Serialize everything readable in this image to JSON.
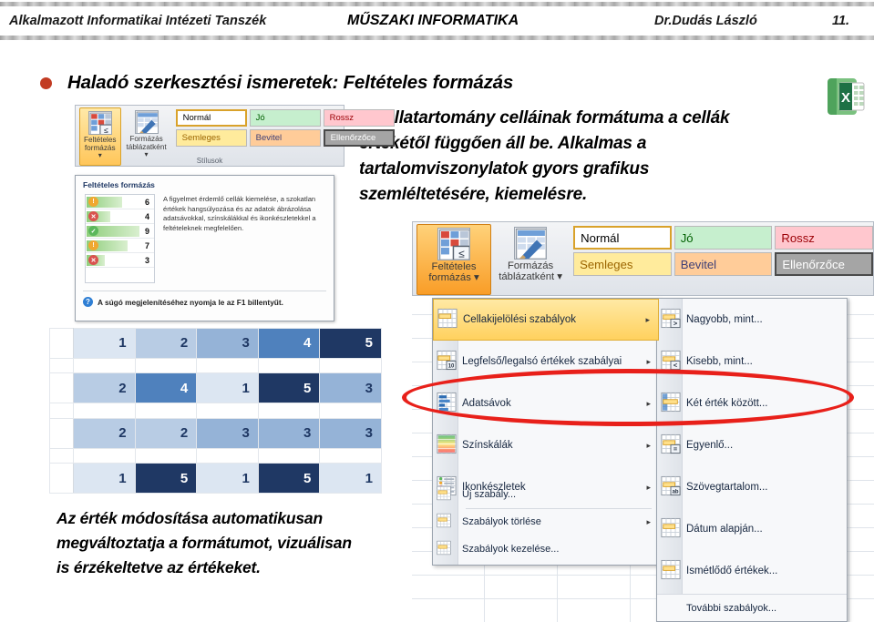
{
  "header": {
    "left": "Alkalmazott Informatikai Intézeti Tanszék",
    "middle": "MŰSZAKI INFORMATIKA",
    "right": "Dr.Dudás László",
    "page": "11."
  },
  "title": {
    "text": "Haladó szerkesztési ismeretek: Feltételes formázás",
    "bullet_color": "#c23b22"
  },
  "body_paragraph": "A cellatartomány celláinak formátuma a cellák értékétől függően áll be. Alkalmas a tartalomviszonylatok gyors grafikus szemléltetésére, kiemelésre.",
  "bottom_paragraph": "Az érték módosítása automatikusan megváltoztatja a formátumot, vizuálisan is érzékeltetve az értékeket.",
  "ribbon": {
    "buttons": [
      {
        "line1": "Feltételes",
        "line2": "formázás ▾"
      },
      {
        "line1": "Formázás",
        "line2": "táblázatként ▾"
      }
    ],
    "styles": [
      {
        "label": "Normál",
        "bg": "#ffffff",
        "fg": "#000000"
      },
      {
        "label": "Jó",
        "bg": "#c6efce",
        "fg": "#006100"
      },
      {
        "label": "Rossz",
        "bg": "#ffc7ce",
        "fg": "#9c0006"
      },
      {
        "label": "Semleges",
        "bg": "#ffeb9c",
        "fg": "#9c6500"
      },
      {
        "label": "Bevitel",
        "bg": "#ffcc99",
        "fg": "#3f3f76"
      },
      {
        "label": "Ellenőrzőce",
        "bg": "#a5a5a5",
        "fg": "#ffffff"
      }
    ],
    "group_label": "Stílusok"
  },
  "tooltip": {
    "title": "Feltételes formázás",
    "description": "A figyelmet érdemlő cellák kiemelése, a szokatlan értékek hangsúlyozása és az adatok ábrázolása adatsávokkal, színskálákkal és ikonkészletekkel a feltételeknek megfelelően.",
    "help_text": "A súgó megjelenítéséhez nyomja le az F1 billentyűt.",
    "help_icon": "question-mark-icon",
    "sample_rows": [
      {
        "value": "6",
        "icon": "warning-icon",
        "icon_color": "#f0a830",
        "glyph": "!",
        "bar_pct": 62
      },
      {
        "value": "4",
        "icon": "error-icon",
        "icon_color": "#d9534f",
        "glyph": "✕",
        "bar_pct": 42
      },
      {
        "value": "9",
        "icon": "check-icon",
        "icon_color": "#5cb85c",
        "glyph": "✓",
        "bar_pct": 92
      },
      {
        "value": "7",
        "icon": "warning-icon",
        "icon_color": "#f0a830",
        "glyph": "!",
        "bar_pct": 72
      },
      {
        "value": "3",
        "icon": "error-icon",
        "icon_color": "#d9534f",
        "glyph": "✕",
        "bar_pct": 32
      }
    ]
  },
  "data_grid": {
    "rows": [
      {
        "values": [
          "1",
          "2",
          "3",
          "4",
          "5"
        ],
        "shades": [
          "#dce6f2",
          "#b8cce4",
          "#95b3d7",
          "#4f81bd",
          "#1f3864"
        ],
        "fgs": [
          "#1f3864",
          "#1f3864",
          "#1f3864",
          "#ffffff",
          "#ffffff"
        ]
      },
      {
        "values": [
          "2",
          "4",
          "1",
          "5",
          "3"
        ],
        "shades": [
          "#b8cce4",
          "#4f81bd",
          "#dce6f2",
          "#1f3864",
          "#95b3d7"
        ],
        "fgs": [
          "#1f3864",
          "#ffffff",
          "#1f3864",
          "#ffffff",
          "#1f3864"
        ]
      },
      {
        "values": [
          "2",
          "2",
          "3",
          "3",
          "3"
        ],
        "shades": [
          "#b8cce4",
          "#b8cce4",
          "#95b3d7",
          "#95b3d7",
          "#95b3d7"
        ],
        "fgs": [
          "#1f3864",
          "#1f3864",
          "#1f3864",
          "#1f3864",
          "#1f3864"
        ]
      },
      {
        "values": [
          "1",
          "5",
          "1",
          "5",
          "1"
        ],
        "shades": [
          "#dce6f2",
          "#1f3864",
          "#dce6f2",
          "#1f3864",
          "#dce6f2"
        ],
        "fgs": [
          "#1f3864",
          "#ffffff",
          "#1f3864",
          "#ffffff",
          "#1f3864"
        ]
      }
    ]
  },
  "menu_main": {
    "items": [
      {
        "label": "Cellakijelölési szabályok",
        "accel": "C",
        "arrow": "▸",
        "selected": true,
        "icon": "highlight-cells-rules-icon"
      },
      {
        "label": "Legfelső/legalsó értékek szabályai",
        "accel": "L",
        "arrow": "▸",
        "selected": false,
        "icon": "top-bottom-rules-icon"
      },
      {
        "label": "Adatsávok",
        "accel": "A",
        "arrow": "▸",
        "selected": false,
        "icon": "data-bars-icon"
      },
      {
        "label": "Színskálák",
        "accel": "S",
        "arrow": "▸",
        "selected": false,
        "icon": "color-scales-icon"
      },
      {
        "label": "Ikonkészletek",
        "accel": "I",
        "arrow": "▸",
        "selected": false,
        "icon": "icon-sets-icon"
      }
    ],
    "footer_items": [
      {
        "label": "Új szabály...",
        "accel": "s",
        "arrow": "",
        "icon": "new-rule-icon"
      },
      {
        "label": "Szabályok törlése",
        "accel": "t",
        "arrow": "▸",
        "icon": "clear-rules-icon"
      },
      {
        "label": "Szabályok kezelése...",
        "accel": "",
        "arrow": "",
        "icon": "manage-rules-icon"
      }
    ]
  },
  "menu_sub": {
    "items": [
      {
        "label": "Nagyobb, mint...",
        "accel": "N",
        "icon": "greater-than-icon",
        "glyph": ">"
      },
      {
        "label": "Kisebb, mint...",
        "accel": "K",
        "icon": "less-than-icon",
        "glyph": "<"
      },
      {
        "label": "Két érték között...",
        "accel": "K",
        "icon": "between-icon",
        "glyph": ""
      },
      {
        "label": "Egyenlő...",
        "accel": "E",
        "icon": "equal-to-icon",
        "glyph": "="
      },
      {
        "label": "Szövegtartalom...",
        "accel": "S",
        "icon": "text-contains-icon",
        "glyph": "ab"
      },
      {
        "label": "Dátum alapján...",
        "accel": "D",
        "icon": "date-occurring-icon",
        "glyph": ""
      },
      {
        "label": "Ismétlődő értékek...",
        "accel": "I",
        "icon": "duplicate-values-icon",
        "glyph": ""
      }
    ],
    "last_item": {
      "label": "További szabályok...",
      "accel": "T",
      "icon": "more-rules-icon"
    }
  },
  "annotation": {
    "shape": "red-ellipse",
    "color": "#e8201a"
  },
  "excel_logo": {
    "name": "excel-application-icon",
    "letter": "X",
    "color": "#1e7145"
  }
}
